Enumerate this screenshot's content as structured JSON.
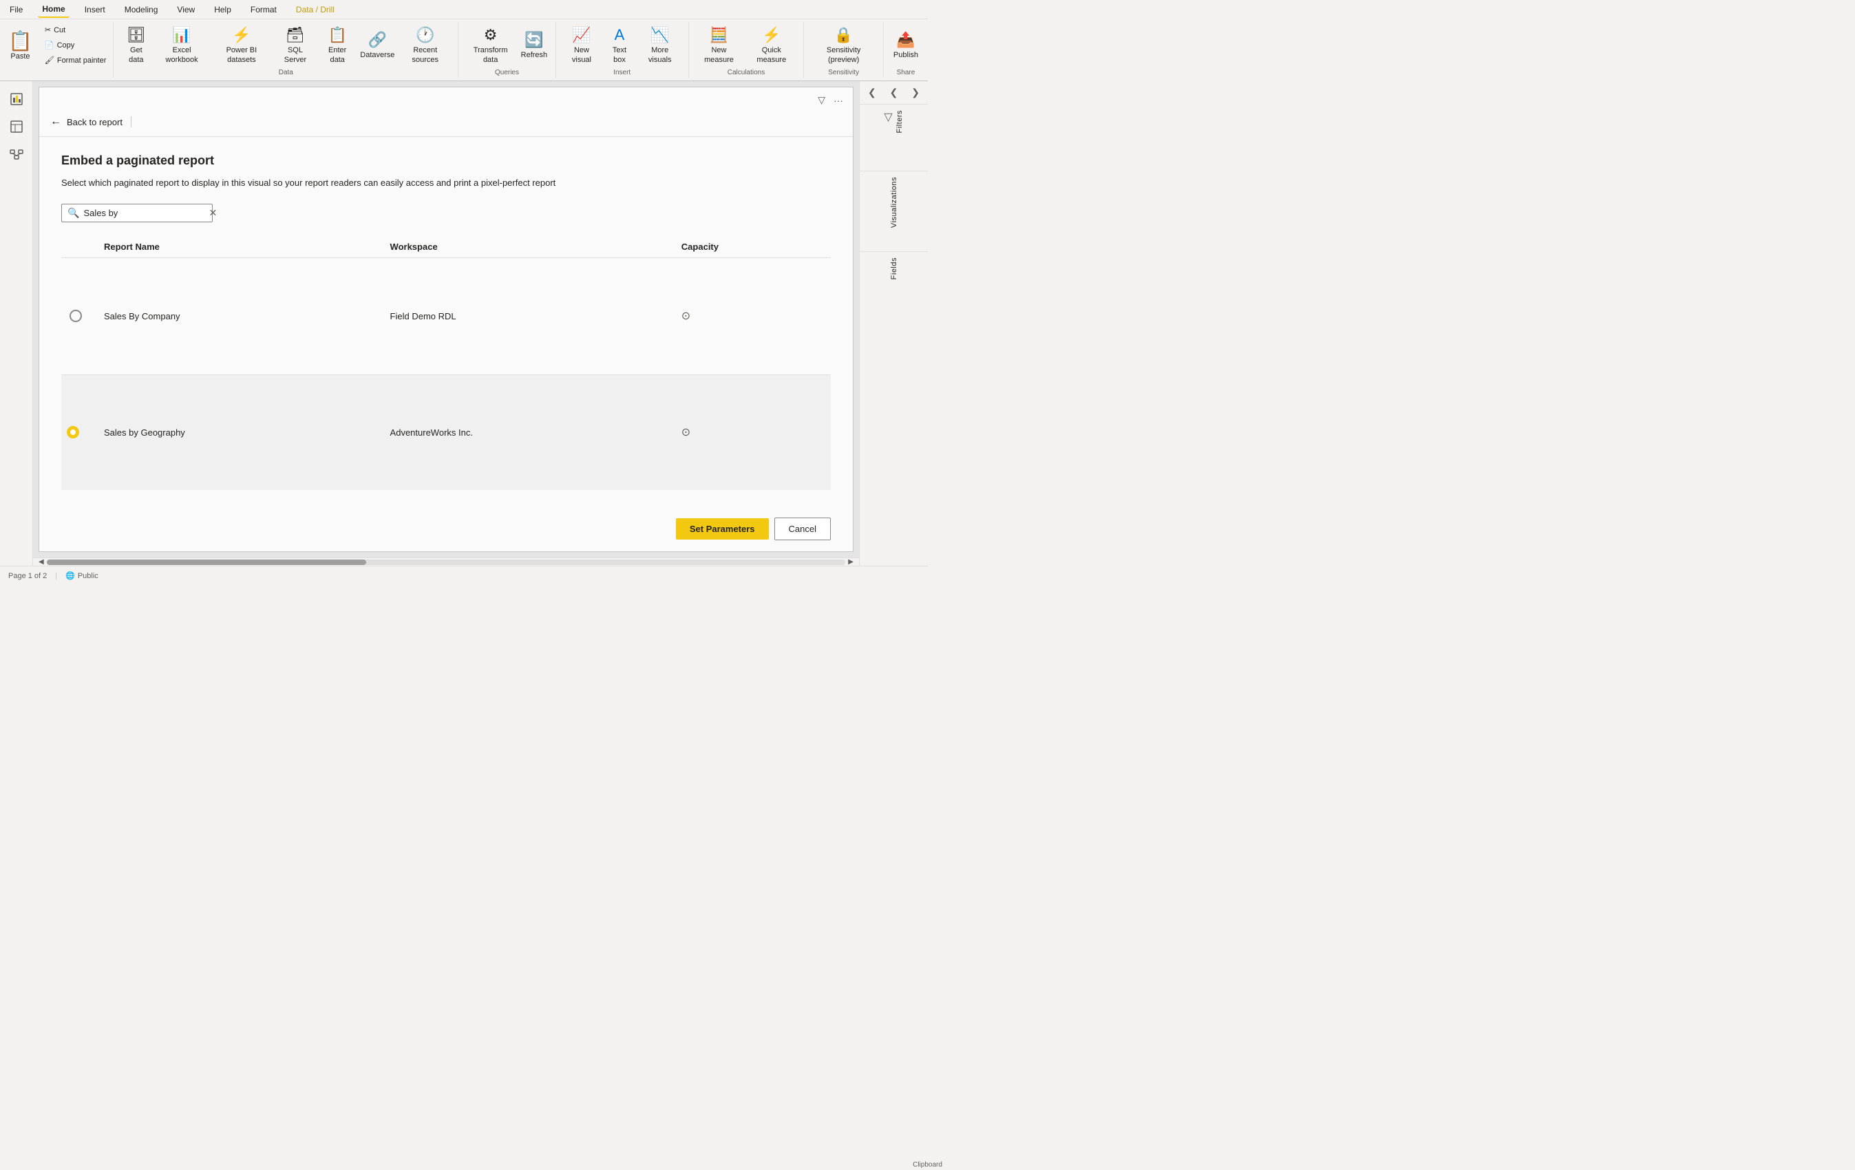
{
  "menu": {
    "items": [
      {
        "label": "File",
        "active": false
      },
      {
        "label": "Home",
        "active": true
      },
      {
        "label": "Insert",
        "active": false
      },
      {
        "label": "Modeling",
        "active": false
      },
      {
        "label": "View",
        "active": false
      },
      {
        "label": "Help",
        "active": false
      },
      {
        "label": "Format",
        "active": false
      },
      {
        "label": "Data / Drill",
        "active": false,
        "special": "datadrill"
      }
    ]
  },
  "ribbon": {
    "clipboard": {
      "label": "Clipboard",
      "paste": "Paste",
      "cut": "Cut",
      "copy": "Copy",
      "format_painter": "Format painter"
    },
    "data": {
      "label": "Data",
      "get_data": "Get data",
      "excel_workbook": "Excel workbook",
      "power_bi_datasets": "Power BI datasets",
      "sql_server": "SQL Server",
      "enter_data": "Enter data",
      "dataverse": "Dataverse",
      "recent_sources": "Recent sources"
    },
    "queries": {
      "label": "Queries",
      "transform_data": "Transform data",
      "refresh": "Refresh"
    },
    "insert": {
      "label": "Insert",
      "new_visual": "New visual",
      "text_box": "Text box",
      "more_visuals": "More visuals"
    },
    "calculations": {
      "label": "Calculations",
      "new_measure": "New measure",
      "quick_measure": "Quick measure"
    },
    "sensitivity": {
      "label": "Sensitivity",
      "sensitivity_preview": "Sensitivity (preview)"
    },
    "share": {
      "label": "Share",
      "publish": "Publish"
    }
  },
  "modal": {
    "back_label": "Back to report",
    "title": "Embed a paginated report",
    "description": "Select which paginated report to display in this visual so your report readers can easily access and print a pixel-perfect report",
    "search_placeholder": "Sales by",
    "table": {
      "headers": [
        "Report Name",
        "Workspace",
        "Capacity"
      ],
      "rows": [
        {
          "id": "row1",
          "selected": false,
          "report_name": "Sales By Company",
          "workspace": "Field Demo RDL",
          "has_capacity": true
        },
        {
          "id": "row2",
          "selected": true,
          "report_name": "Sales by Geography",
          "workspace": "AdventureWorks Inc.",
          "has_capacity": true
        }
      ]
    },
    "set_parameters_btn": "Set Parameters",
    "cancel_btn": "Cancel"
  },
  "right_panel": {
    "visualizations_label": "Visualizations",
    "filters_label": "Filters",
    "fields_label": "Fields"
  },
  "status_bar": {
    "page_info": "Page 1 of 2",
    "public_label": "Public"
  }
}
